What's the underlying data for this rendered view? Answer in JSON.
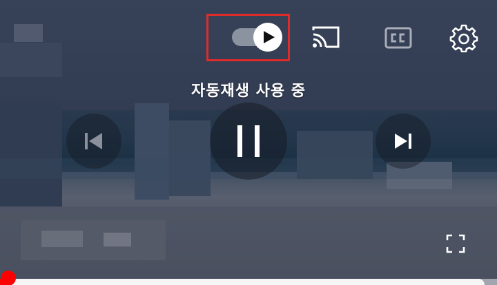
{
  "player": {
    "autoplay": {
      "enabled": true,
      "status_text": "자동재생 사용 중"
    },
    "icons": {
      "autoplay_toggle": "play-icon",
      "cast": "cast-icon",
      "captions": "closed-captions-icon",
      "settings": "gear-icon",
      "previous": "skip-previous-icon",
      "pause": "pause-icon",
      "next": "skip-next-icon",
      "fullscreen": "fullscreen-icon"
    },
    "captions_enabled": false,
    "progress": {
      "played_fraction": 0.01
    },
    "colors": {
      "highlight": "#e02b2b",
      "progress": "#ff0000",
      "icon": "#ffffff"
    }
  }
}
